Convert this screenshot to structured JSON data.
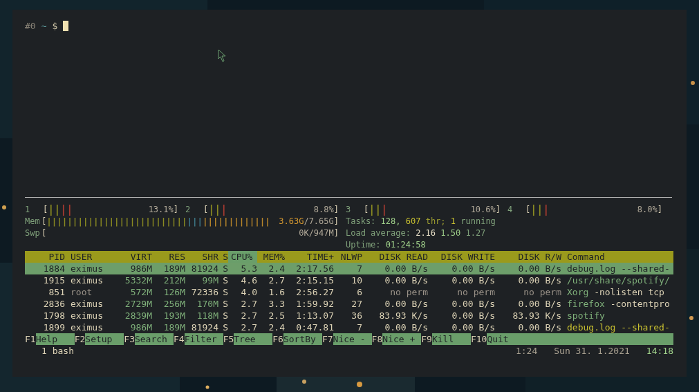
{
  "prompt": [
    {
      "text": "#0",
      "color": "#8a8478"
    },
    {
      "text": "~",
      "color": "#5f9ea0"
    },
    {
      "text": "$",
      "color": "#cfc6a8"
    }
  ],
  "left_column": {
    "cpu_meters": [
      {
        "label": "1",
        "open": "[",
        "close": "]",
        "segments": [
          {
            "text": "||",
            "color": "#8a8a22"
          },
          {
            "text": "||",
            "color": "#a83a30"
          }
        ],
        "reading": [
          {
            "text": "13.1%",
            "color": "#b0a898"
          }
        ]
      },
      {
        "label": "2",
        "open": "[",
        "close": "]",
        "segments": [
          {
            "text": "||",
            "color": "#8a8a22"
          },
          {
            "text": "|",
            "color": "#a83a30"
          }
        ],
        "reading": [
          {
            "text": "8.8%",
            "color": "#b0a898"
          }
        ]
      }
    ],
    "meters": [
      {
        "label": "Mem",
        "open": "[",
        "close": "]",
        "segments": [
          {
            "text": "|||||||||||||||||||||||||||",
            "color": "#8a8a22"
          },
          {
            "text": "|||",
            "color": "#3e7a8a"
          },
          {
            "text": "|||||||||||||",
            "color": "#b8862a"
          }
        ],
        "reading": [
          {
            "text": "3.63G",
            "color": "#d89a30"
          },
          {
            "text": "/7.65G",
            "color": "#b0a898"
          }
        ]
      },
      {
        "label": "Swp",
        "open": "[",
        "close": "]",
        "reading": [
          {
            "text": "0K/947M",
            "color": "#b0a898"
          }
        ]
      }
    ]
  },
  "right_column": {
    "cpu_meters": [
      {
        "label": "3",
        "open": "[",
        "close": "]",
        "segments": [
          {
            "text": "||",
            "color": "#8a8a22"
          },
          {
            "text": "|",
            "color": "#a83a30"
          }
        ],
        "reading": [
          {
            "text": "10.6%",
            "color": "#b0a898"
          }
        ]
      },
      {
        "label": "4",
        "open": "[",
        "close": "]",
        "segments": [
          {
            "text": "||",
            "color": "#8a8a22"
          },
          {
            "text": "|",
            "color": "#a83a30"
          }
        ],
        "reading": [
          {
            "text": "8.0%",
            "color": "#b0a898"
          }
        ]
      }
    ],
    "info_lines": [
      [
        {
          "text": "Tasks:",
          "color": "#7fa07a"
        },
        {
          "text": "128,",
          "color": "#9fd08a"
        },
        {
          "text": "607",
          "color": "#c8c030"
        },
        {
          "text": "thr;",
          "color": "#9a9a30"
        },
        {
          "text": "1",
          "color": "#c8c030"
        },
        {
          "text": "running",
          "color": "#7fa07a"
        }
      ],
      [
        {
          "text": "Load average:",
          "color": "#7fa07a"
        },
        {
          "text": "2.16",
          "color": "#e8e0c8"
        },
        {
          "text": "1.50",
          "color": "#9fd08a"
        },
        {
          "text": "1.27",
          "color": "#7fa07a"
        }
      ],
      [
        {
          "text": "Uptime:",
          "color": "#7fa07a"
        },
        {
          "text": "01:24:58",
          "color": "#9fd08a"
        }
      ]
    ]
  },
  "table": {
    "columns": [
      {
        "label": "PID",
        "sorted": false
      },
      {
        "label": "USER",
        "sorted": false
      },
      {
        "label": "VIRT",
        "sorted": false
      },
      {
        "label": "RES",
        "sorted": false
      },
      {
        "label": "SHR",
        "sorted": false
      },
      {
        "label": "S",
        "sorted": false
      },
      {
        "label": "CPU%",
        "sorted": true
      },
      {
        "label": "MEM%",
        "sorted": false
      },
      {
        "label": "TIME+",
        "sorted": false
      },
      {
        "label": "NLWP",
        "sorted": false
      },
      {
        "label": "DISK READ",
        "sorted": false
      },
      {
        "label": "DISK WRITE",
        "sorted": false
      },
      {
        "label": "DISK R/W",
        "sorted": false
      },
      {
        "label": "Command",
        "sorted": false
      }
    ],
    "rows": [
      {
        "selected": true,
        "cells": [
          {
            "text": "1884"
          },
          {
            "text": "eximus"
          },
          {
            "text": "986M"
          },
          {
            "text": "189M"
          },
          {
            "text": "81924"
          },
          {
            "text": "S"
          },
          {
            "text": "5.3"
          },
          {
            "text": "2.4"
          },
          {
            "text": "2:17.56"
          },
          {
            "text": "7"
          },
          {
            "text": "0.00 B/s"
          },
          {
            "text": "0.00 B/s"
          },
          {
            "text": "0.00 B/s"
          },
          {
            "parts": [
              {
                "text": "debug.log --shared-"
              }
            ]
          }
        ]
      },
      {
        "selected": false,
        "cells": [
          {
            "text": "1915",
            "color": "#ddd3b6"
          },
          {
            "text": "eximus",
            "color": "#ddd3b6"
          },
          {
            "text": "5332M",
            "color": "#7fb07a"
          },
          {
            "text": "212M",
            "color": "#7fb07a"
          },
          {
            "text": "99M",
            "color": "#7fb07a"
          },
          {
            "text": "S",
            "color": "#ddd3b6"
          },
          {
            "text": "4.6",
            "color": "#ddd3b6"
          },
          {
            "text": "2.7",
            "color": "#ddd3b6"
          },
          {
            "text": "2:15.15",
            "color": "#ddd3b6"
          },
          {
            "text": "10",
            "color": "#ddd3b6"
          },
          {
            "text": "0.00 B/s",
            "color": "#ddd3b6"
          },
          {
            "text": "0.00 B/s",
            "color": "#ddd3b6"
          },
          {
            "text": "0.00 B/s",
            "color": "#ddd3b6"
          },
          {
            "parts": [
              {
                "text": "/usr/share/spotify/",
                "color": "#7fb07a"
              }
            ]
          }
        ]
      },
      {
        "selected": false,
        "cells": [
          {
            "text": "851",
            "color": "#ddd3b6"
          },
          {
            "text": "root",
            "color": "#9a9288"
          },
          {
            "text": "572M",
            "color": "#7fb07a"
          },
          {
            "text": "126M",
            "color": "#7fb07a"
          },
          {
            "text": "72336",
            "color": "#ddd3b6"
          },
          {
            "text": "S",
            "color": "#ddd3b6"
          },
          {
            "text": "4.0",
            "color": "#ddd3b6"
          },
          {
            "text": "1.6",
            "color": "#ddd3b6"
          },
          {
            "text": "2:56.27",
            "color": "#ddd3b6"
          },
          {
            "text": "6",
            "color": "#ddd3b6"
          },
          {
            "text": "no perm",
            "color": "#9a9288"
          },
          {
            "text": "no perm",
            "color": "#9a9288"
          },
          {
            "text": "no perm",
            "color": "#9a9288"
          },
          {
            "parts": [
              {
                "text": "Xorg",
                "color": "#7fb07a"
              },
              {
                "text": "-nolisten tcp",
                "color": "#ddd3b6"
              }
            ]
          }
        ]
      },
      {
        "selected": false,
        "cells": [
          {
            "text": "2836",
            "color": "#ddd3b6"
          },
          {
            "text": "eximus",
            "color": "#ddd3b6"
          },
          {
            "text": "2729M",
            "color": "#7fb07a"
          },
          {
            "text": "256M",
            "color": "#7fb07a"
          },
          {
            "text": "170M",
            "color": "#7fb07a"
          },
          {
            "text": "S",
            "color": "#ddd3b6"
          },
          {
            "text": "2.7",
            "color": "#ddd3b6"
          },
          {
            "text": "3.3",
            "color": "#ddd3b6"
          },
          {
            "text": "1:59.92",
            "color": "#ddd3b6"
          },
          {
            "text": "27",
            "color": "#ddd3b6"
          },
          {
            "text": "0.00 B/s",
            "color": "#ddd3b6"
          },
          {
            "text": "0.00 B/s",
            "color": "#ddd3b6"
          },
          {
            "text": "0.00 B/s",
            "color": "#ddd3b6"
          },
          {
            "parts": [
              {
                "text": "firefox",
                "color": "#7fb07a"
              },
              {
                "text": "-contentpro",
                "color": "#ddd3b6"
              }
            ]
          }
        ]
      },
      {
        "selected": false,
        "cells": [
          {
            "text": "1798",
            "color": "#ddd3b6"
          },
          {
            "text": "eximus",
            "color": "#ddd3b6"
          },
          {
            "text": "2839M",
            "color": "#7fb07a"
          },
          {
            "text": "193M",
            "color": "#7fb07a"
          },
          {
            "text": "118M",
            "color": "#7fb07a"
          },
          {
            "text": "S",
            "color": "#ddd3b6"
          },
          {
            "text": "2.7",
            "color": "#ddd3b6"
          },
          {
            "text": "2.5",
            "color": "#ddd3b6"
          },
          {
            "text": "1:13.07",
            "color": "#ddd3b6"
          },
          {
            "text": "36",
            "color": "#ddd3b6"
          },
          {
            "text": "83.93 K/s",
            "color": "#ddd3b6"
          },
          {
            "text": "0.00 B/s",
            "color": "#ddd3b6"
          },
          {
            "text": "83.93 K/s",
            "color": "#ddd3b6"
          },
          {
            "parts": [
              {
                "text": "spotify",
                "color": "#7fb07a"
              }
            ]
          }
        ]
      },
      {
        "selected": false,
        "cells": [
          {
            "text": "1899",
            "color": "#ddd3b6"
          },
          {
            "text": "eximus",
            "color": "#ddd3b6"
          },
          {
            "text": "986M",
            "color": "#7fb07a"
          },
          {
            "text": "189M",
            "color": "#7fb07a"
          },
          {
            "text": "81924",
            "color": "#ddd3b6"
          },
          {
            "text": "S",
            "color": "#ddd3b6"
          },
          {
            "text": "2.7",
            "color": "#ddd3b6"
          },
          {
            "text": "2.4",
            "color": "#ddd3b6"
          },
          {
            "text": "0:47.81",
            "color": "#ddd3b6"
          },
          {
            "text": "7",
            "color": "#ddd3b6"
          },
          {
            "text": "0.00 B/s",
            "color": "#ddd3b6"
          },
          {
            "text": "0.00 B/s",
            "color": "#ddd3b6"
          },
          {
            "text": "0.00 B/s",
            "color": "#ddd3b6"
          },
          {
            "parts": [
              {
                "text": "debug.log --shared-",
                "color": "#c8c030"
              }
            ]
          }
        ]
      }
    ]
  },
  "function_keys": [
    {
      "key": "F1",
      "label": "Help"
    },
    {
      "key": "F2",
      "label": "Setup"
    },
    {
      "key": "F3",
      "label": "Search"
    },
    {
      "key": "F4",
      "label": "Filter"
    },
    {
      "key": "F5",
      "label": "Tree"
    },
    {
      "key": "F6",
      "label": "SortBy"
    },
    {
      "key": "F7",
      "label": "Nice -"
    },
    {
      "key": "F8",
      "label": "Nice +"
    },
    {
      "key": "F9",
      "label": "Kill"
    },
    {
      "key": "F10",
      "label": "Quit"
    }
  ],
  "status_bar": {
    "window": "1 bash",
    "load": "1:24",
    "date": "Sun 31. 1.2021",
    "time": "14:18"
  }
}
